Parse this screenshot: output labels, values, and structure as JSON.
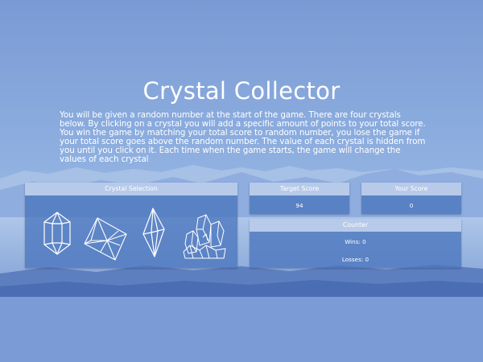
{
  "game": {
    "title": "Crystal Collector",
    "instructions": "You will be given a random number at the start of the game. There are four crystals below. By clicking on a crystal you will add a specific amount of points to your total score. You win the game by matching your total score to random number, you lose the game if your total score goes above the random number. The value of each crystal is hidden from you until you click on it. Each time when the game starts, the game will change the values of each crystal"
  },
  "crystal_panel": {
    "header": "Crystal Selection",
    "crystals": [
      {
        "icon": "hexagonal-crystal-icon"
      },
      {
        "icon": "octahedron-crystal-icon"
      },
      {
        "icon": "bipyramid-crystal-icon"
      },
      {
        "icon": "crystal-cluster-icon"
      }
    ]
  },
  "target_panel": {
    "header": "Target Score",
    "value": "94"
  },
  "score_panel": {
    "header": "Your Score",
    "value": "0"
  },
  "counter_panel": {
    "header": "Counter",
    "wins": "Wins: 0",
    "losses": "Losses: 0"
  },
  "colors": {
    "background": "#7b9bd6",
    "panel": "#4a76be",
    "panel_header": "#b7caea",
    "text": "#ffffff"
  }
}
